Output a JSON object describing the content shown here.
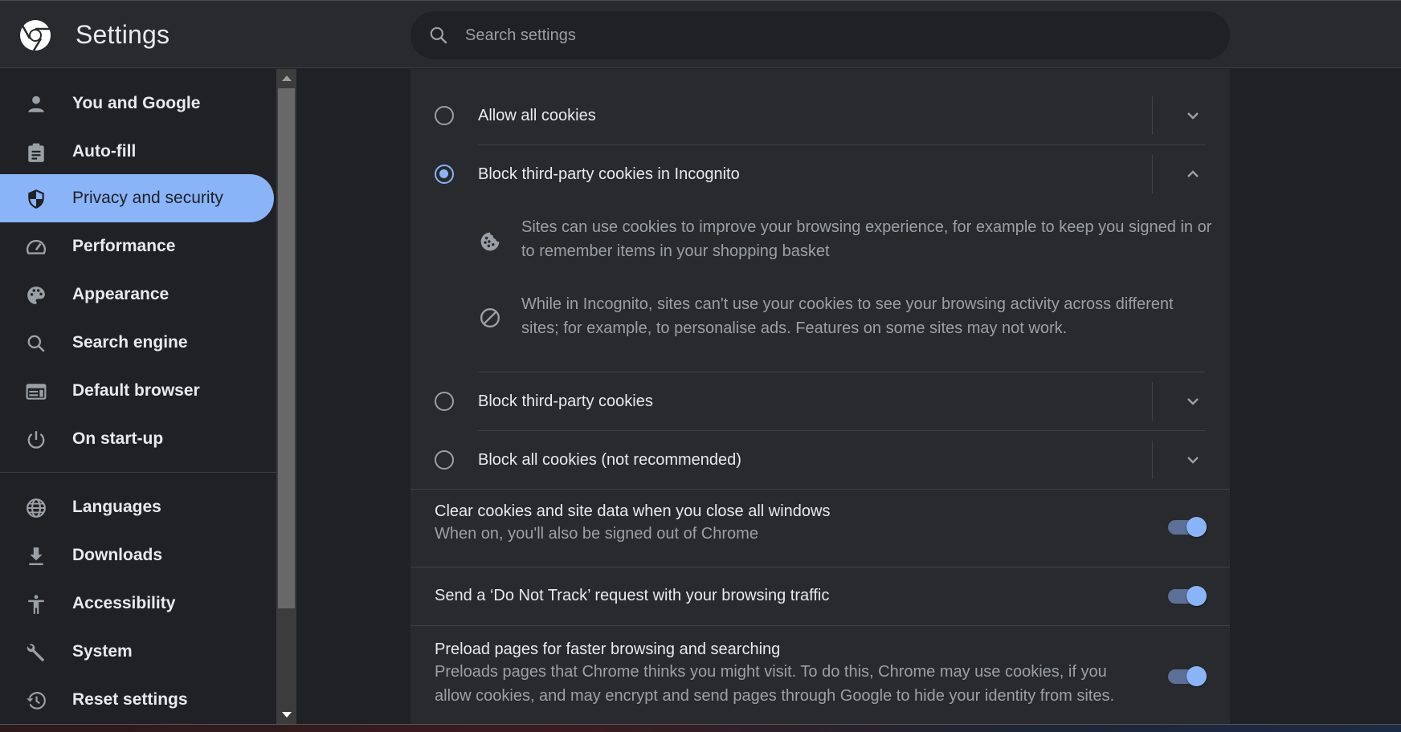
{
  "header": {
    "title": "Settings",
    "search": {
      "placeholder": "Search settings",
      "value": ""
    }
  },
  "sidebar": {
    "items": [
      {
        "label": "You and Google",
        "icon": "person-icon",
        "active": false
      },
      {
        "label": "Auto-fill",
        "icon": "clipboard-icon",
        "active": false
      },
      {
        "label": "Privacy and security",
        "icon": "shield-icon",
        "active": true
      },
      {
        "label": "Performance",
        "icon": "speedometer-icon",
        "active": false
      },
      {
        "label": "Appearance",
        "icon": "palette-icon",
        "active": false
      },
      {
        "label": "Search engine",
        "icon": "search-icon",
        "active": false
      },
      {
        "label": "Default browser",
        "icon": "browser-window-icon",
        "active": false
      },
      {
        "label": "On start-up",
        "icon": "power-icon",
        "active": false
      },
      {
        "label": "Languages",
        "icon": "globe-icon",
        "active": false
      },
      {
        "label": "Downloads",
        "icon": "download-icon",
        "active": false
      },
      {
        "label": "Accessibility",
        "icon": "accessibility-icon",
        "active": false
      },
      {
        "label": "System",
        "icon": "wrench-icon",
        "active": false
      },
      {
        "label": "Reset settings",
        "icon": "history-icon",
        "active": false
      }
    ]
  },
  "cookies": {
    "options": [
      {
        "label": "Allow all cookies",
        "selected": false,
        "expanded": false
      },
      {
        "label": "Block third-party cookies in Incognito",
        "selected": true,
        "expanded": true
      },
      {
        "label": "Block third-party cookies",
        "selected": false,
        "expanded": false
      },
      {
        "label": "Block all cookies (not recommended)",
        "selected": false,
        "expanded": false
      }
    ],
    "details": [
      {
        "icon": "cookie-icon",
        "text": "Sites can use cookies to improve your browsing experience, for example to keep you signed in or to remember items in your shopping basket"
      },
      {
        "icon": "block-icon",
        "text": "While in Incognito, sites can't use your cookies to see your browsing activity across different sites; for example, to personalise ads. Features on some sites may not work."
      }
    ]
  },
  "toggles": [
    {
      "title": "Clear cookies and site data when you close all windows",
      "subtitle": "When on, you'll also be signed out of Chrome",
      "on": true
    },
    {
      "title": "Send a ‘Do Not Track’ request with your browsing traffic",
      "subtitle": "",
      "on": true
    },
    {
      "title": "Preload pages for faster browsing and searching",
      "subtitle": "Preloads pages that Chrome thinks you might visit. To do this, Chrome may use cookies, if you allow cookies, and may encrypt and send pages through Google to hide your identity from sites.",
      "on": true
    }
  ],
  "colors": {
    "accent": "#8ab4f8",
    "background": "#202124",
    "surface": "#292a2d",
    "text": "#e8eaed",
    "secondary_text": "#9aa0a6"
  }
}
